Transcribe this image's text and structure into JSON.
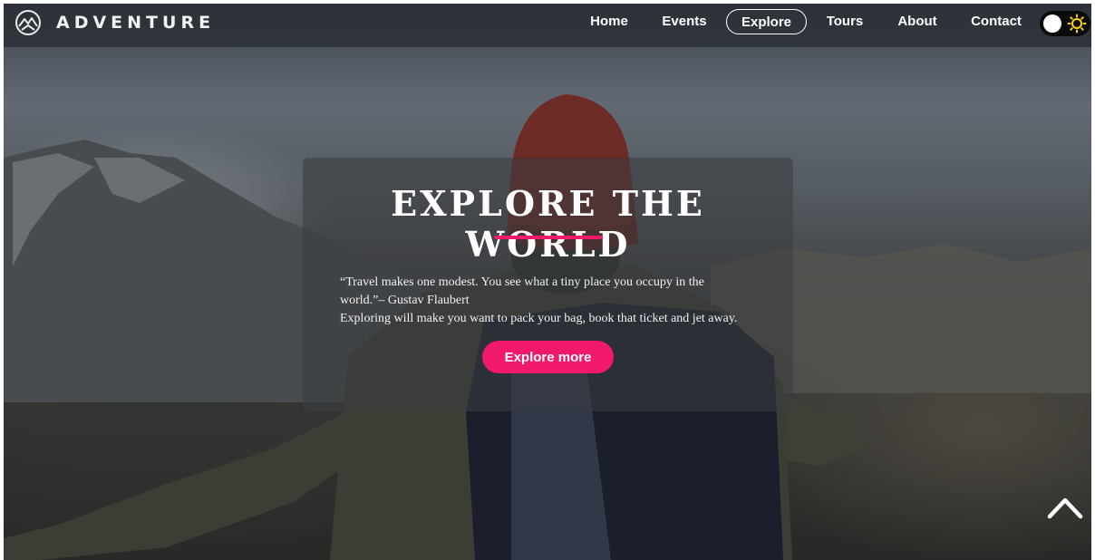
{
  "brand": {
    "name": "ADVENTURE",
    "logo_icon": "mountain-circle-icon"
  },
  "nav": {
    "links": [
      {
        "label": "Home",
        "active": false
      },
      {
        "label": "Events",
        "active": false
      },
      {
        "label": "Explore",
        "active": true
      },
      {
        "label": "Tours",
        "active": false
      },
      {
        "label": "About",
        "active": false
      },
      {
        "label": "Contact",
        "active": false
      }
    ],
    "theme_toggle": {
      "icon": "sun-icon",
      "state": "light"
    }
  },
  "hero": {
    "title": "EXPLORE THE WORLD",
    "quote_line1": "“Travel makes one modest. You see what a tiny place you occupy in the",
    "quote_line2": "world.”– Gustav Flaubert",
    "quote_line3": "Exploring will make you want to pack your bag, book that ticket and jet away.",
    "button_label": "Explore more"
  },
  "back_to_top": {
    "icon": "chevron-up-icon"
  },
  "colors": {
    "accent": "#f0196a",
    "navbar": "#2a2e36",
    "card": "#3a3c40",
    "toggle_track": "#0b0b0c",
    "sun": "#ffd400"
  }
}
